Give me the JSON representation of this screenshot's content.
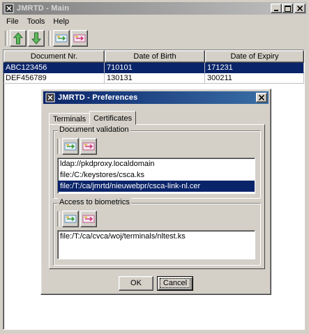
{
  "main": {
    "title": "JMRTD - Main",
    "menu": [
      "File",
      "Tools",
      "Help"
    ],
    "table": {
      "headers": [
        "Document Nr.",
        "Date of Birth",
        "Date of Expiry"
      ],
      "rows": [
        [
          "ABC123456",
          "710101",
          "171231"
        ],
        [
          "DEF456789",
          "130131",
          "300211"
        ]
      ],
      "selected_row": 0
    }
  },
  "dialog": {
    "title": "JMRTD - Preferences",
    "tabs": [
      "Terminals",
      "Certificates"
    ],
    "active_tab": 1,
    "document_validation": {
      "legend": "Document validation",
      "items": [
        "ldap://pkdproxy.localdomain",
        "file:/C:/keystores/csca.ks",
        "file:/T:/ca/jmrtd/nieuwebpr/csca-link-nl.cer"
      ],
      "selected_index": 2
    },
    "access_to_biometrics": {
      "legend": "Access to biometrics",
      "items": [
        "file:/T:/ca/cvca/woj/terminals/nltest.ks"
      ]
    },
    "ok_label": "OK",
    "cancel_label": "Cancel"
  },
  "colors": {
    "selection": "#0a246a",
    "active_title": "#0a246a",
    "inactive_title": "#808080",
    "face": "#d4d0c8"
  },
  "icons": [
    "app-icon",
    "arrow-up-icon",
    "arrow-down-icon",
    "card-add-icon",
    "card-remove-icon",
    "minimize-icon",
    "maximize-icon",
    "close-icon"
  ]
}
